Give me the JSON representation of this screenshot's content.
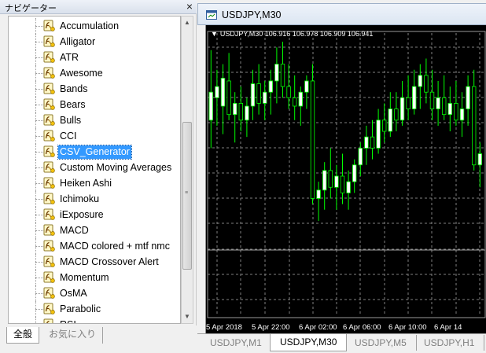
{
  "navigator": {
    "title": "ナビゲーター",
    "close": "×",
    "selected_index": 8,
    "items": [
      {
        "label": "Accumulation"
      },
      {
        "label": "Alligator"
      },
      {
        "label": "ATR"
      },
      {
        "label": "Awesome"
      },
      {
        "label": "Bands"
      },
      {
        "label": "Bears"
      },
      {
        "label": "Bulls"
      },
      {
        "label": "CCI"
      },
      {
        "label": "CSV_Generator"
      },
      {
        "label": "Custom Moving Averages"
      },
      {
        "label": "Heiken Ashi"
      },
      {
        "label": "Ichimoku"
      },
      {
        "label": "iExposure"
      },
      {
        "label": "MACD"
      },
      {
        "label": "MACD colored + mtf nmc"
      },
      {
        "label": "MACD Crossover Alert"
      },
      {
        "label": "Momentum"
      },
      {
        "label": "OsMA"
      },
      {
        "label": "Parabolic"
      },
      {
        "label": "RSI"
      }
    ],
    "tabs": {
      "all": "全般",
      "favorites": "お気に入り"
    }
  },
  "chart": {
    "window_title": "USDJPY,M30",
    "info_line": "USDJPY,M30  106.916 106.978 106.909 106.941",
    "x_labels": [
      "5 Apr 2018",
      "5 Apr 22:00",
      "6 Apr 02:00",
      "6 Apr 06:00",
      "6 Apr 10:00",
      "6 Apr 14"
    ],
    "colors": {
      "background": "#000000",
      "bull_candle": "#ffffff",
      "bear_candle": "#000000",
      "wick": "#00ff00",
      "grid": "#808080"
    }
  },
  "chart_data": {
    "type": "candlestick",
    "symbol": "USDJPY",
    "timeframe": "M30",
    "x_tick_labels": [
      "5 Apr 2018",
      "5 Apr 22:00",
      "6 Apr 02:00",
      "6 Apr 06:00",
      "6 Apr 10:00",
      "6 Apr 14"
    ],
    "last_bar": {
      "open": 106.916,
      "high": 106.978,
      "low": 106.909,
      "close": 106.941
    },
    "grid": true,
    "candles_relative_level": [
      {
        "o": 0.3,
        "h": 0.05,
        "l": 0.4,
        "c": 0.2
      },
      {
        "o": 0.22,
        "h": 0.12,
        "l": 0.32,
        "c": 0.18
      },
      {
        "o": 0.25,
        "h": 0.1,
        "l": 0.35,
        "c": 0.15
      },
      {
        "o": 0.16,
        "h": 0.06,
        "l": 0.3,
        "c": 0.28
      },
      {
        "o": 0.28,
        "h": 0.2,
        "l": 0.38,
        "c": 0.24
      },
      {
        "o": 0.24,
        "h": 0.18,
        "l": 0.34,
        "c": 0.3
      },
      {
        "o": 0.3,
        "h": 0.22,
        "l": 0.36,
        "c": 0.25
      },
      {
        "o": 0.25,
        "h": 0.12,
        "l": 0.3,
        "c": 0.17
      },
      {
        "o": 0.17,
        "h": 0.1,
        "l": 0.28,
        "c": 0.24
      },
      {
        "o": 0.24,
        "h": 0.16,
        "l": 0.3,
        "c": 0.2
      },
      {
        "o": 0.2,
        "h": 0.12,
        "l": 0.28,
        "c": 0.16
      },
      {
        "o": 0.16,
        "h": 0.04,
        "l": 0.24,
        "c": 0.1
      },
      {
        "o": 0.1,
        "h": 0.02,
        "l": 0.22,
        "c": 0.18
      },
      {
        "o": 0.18,
        "h": 0.1,
        "l": 0.26,
        "c": 0.22
      },
      {
        "o": 0.22,
        "h": 0.14,
        "l": 0.3,
        "c": 0.25
      },
      {
        "o": 0.25,
        "h": 0.18,
        "l": 0.32,
        "c": 0.2
      },
      {
        "o": 0.2,
        "h": 0.14,
        "l": 0.26,
        "c": 0.16
      },
      {
        "o": 0.16,
        "h": 0.1,
        "l": 0.6,
        "c": 0.58
      },
      {
        "o": 0.58,
        "h": 0.52,
        "l": 0.66,
        "c": 0.55
      },
      {
        "o": 0.55,
        "h": 0.45,
        "l": 0.62,
        "c": 0.48
      },
      {
        "o": 0.48,
        "h": 0.4,
        "l": 0.58,
        "c": 0.54
      },
      {
        "o": 0.54,
        "h": 0.46,
        "l": 0.62,
        "c": 0.5
      },
      {
        "o": 0.5,
        "h": 0.42,
        "l": 0.6,
        "c": 0.56
      },
      {
        "o": 0.56,
        "h": 0.48,
        "l": 0.62,
        "c": 0.52
      },
      {
        "o": 0.52,
        "h": 0.44,
        "l": 0.56,
        "c": 0.46
      },
      {
        "o": 0.46,
        "h": 0.38,
        "l": 0.5,
        "c": 0.4
      },
      {
        "o": 0.4,
        "h": 0.32,
        "l": 0.46,
        "c": 0.36
      },
      {
        "o": 0.36,
        "h": 0.3,
        "l": 0.44,
        "c": 0.4
      },
      {
        "o": 0.4,
        "h": 0.26,
        "l": 0.42,
        "c": 0.3
      },
      {
        "o": 0.3,
        "h": 0.24,
        "l": 0.38,
        "c": 0.34
      },
      {
        "o": 0.34,
        "h": 0.2,
        "l": 0.36,
        "c": 0.26
      },
      {
        "o": 0.26,
        "h": 0.2,
        "l": 0.34,
        "c": 0.3
      },
      {
        "o": 0.3,
        "h": 0.16,
        "l": 0.32,
        "c": 0.22
      },
      {
        "o": 0.22,
        "h": 0.14,
        "l": 0.3,
        "c": 0.26
      },
      {
        "o": 0.26,
        "h": 0.12,
        "l": 0.28,
        "c": 0.18
      },
      {
        "o": 0.18,
        "h": 0.1,
        "l": 0.26,
        "c": 0.14
      },
      {
        "o": 0.14,
        "h": 0.08,
        "l": 0.24,
        "c": 0.2
      },
      {
        "o": 0.2,
        "h": 0.12,
        "l": 0.3,
        "c": 0.26
      },
      {
        "o": 0.26,
        "h": 0.16,
        "l": 0.32,
        "c": 0.22
      },
      {
        "o": 0.22,
        "h": 0.14,
        "l": 0.3,
        "c": 0.28
      },
      {
        "o": 0.28,
        "h": 0.18,
        "l": 0.34,
        "c": 0.24
      },
      {
        "o": 0.24,
        "h": 0.16,
        "l": 0.32,
        "c": 0.3
      },
      {
        "o": 0.3,
        "h": 0.2,
        "l": 0.36,
        "c": 0.26
      },
      {
        "o": 0.26,
        "h": 0.14,
        "l": 0.32,
        "c": 0.18
      },
      {
        "o": 0.18,
        "h": 0.12,
        "l": 0.48,
        "c": 0.46
      },
      {
        "o": 0.46,
        "h": 0.38,
        "l": 0.54,
        "c": 0.42
      }
    ]
  }
}
